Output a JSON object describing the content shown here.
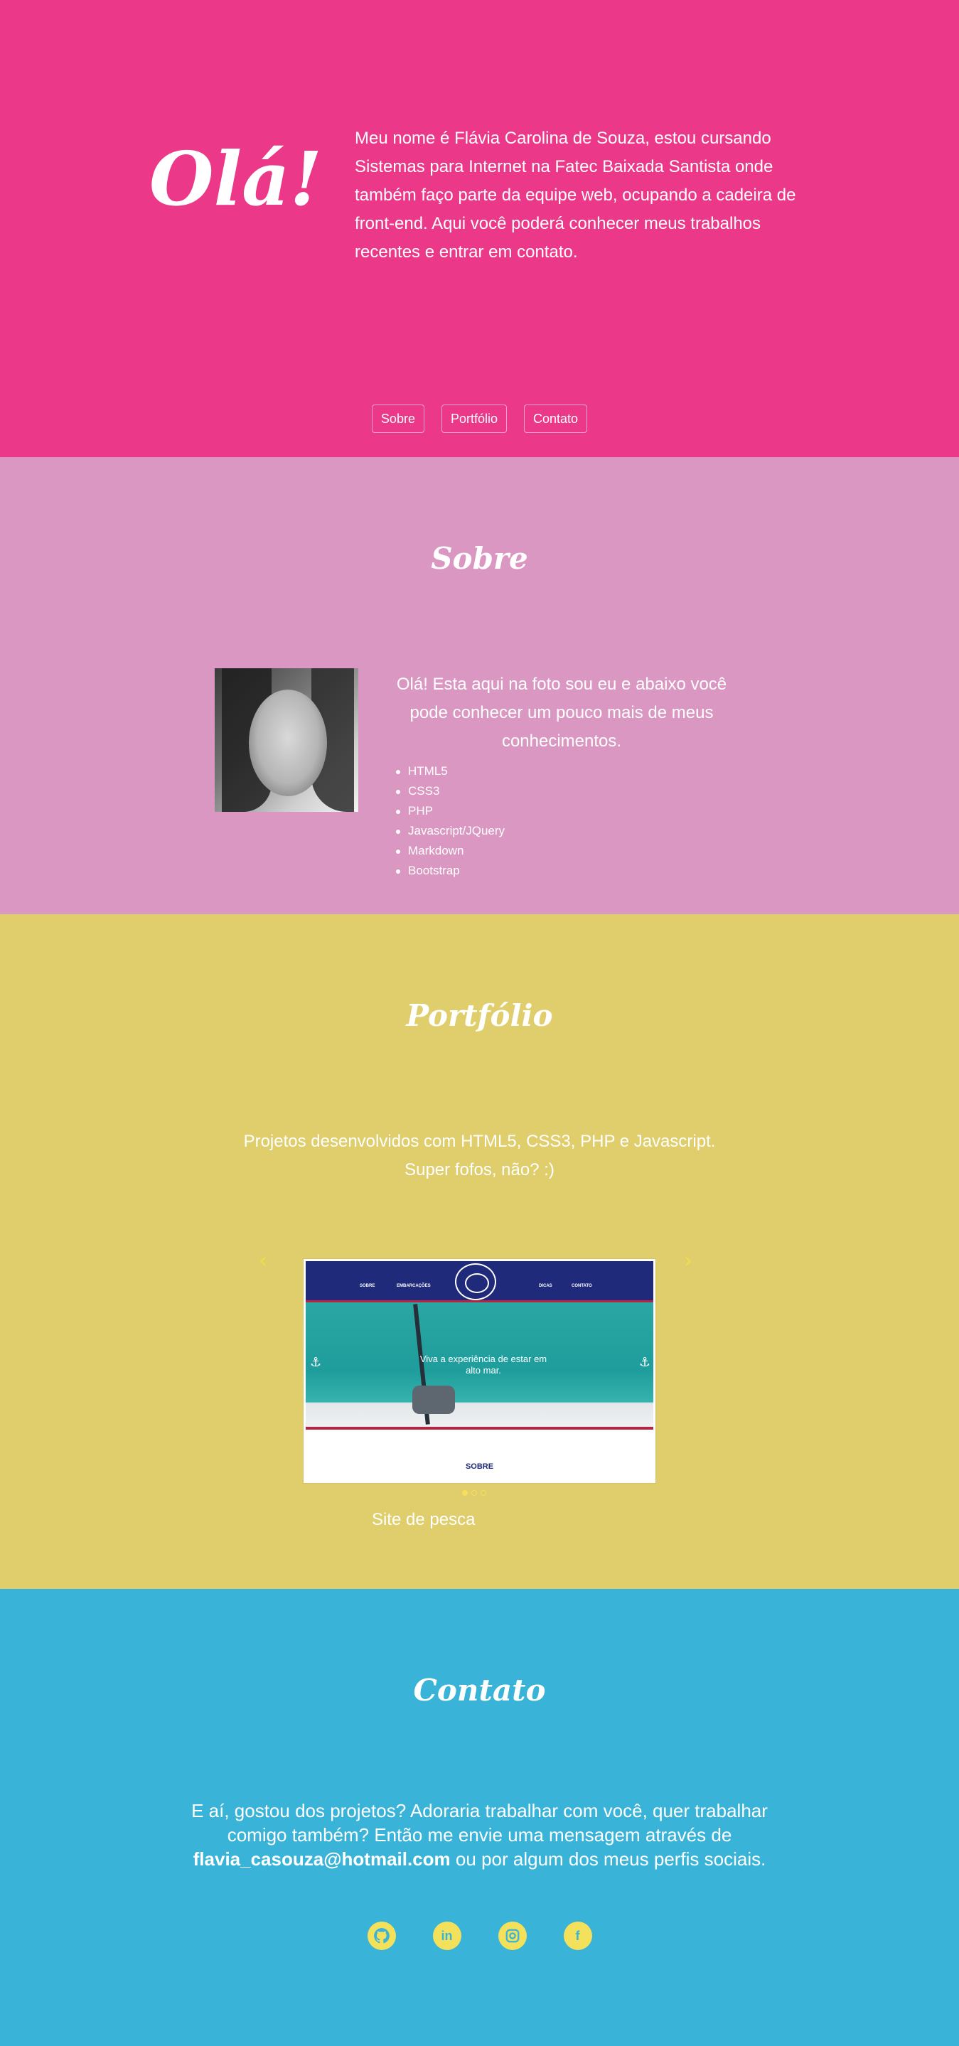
{
  "hero": {
    "title": "Olá!",
    "text": "Meu nome é Flávia Carolina de Souza, estou cursando Sistemas para Internet na Fatec Baixada Santista onde também faço parte da equipe web, ocupando a cadeira de front-end. Aqui você poderá conhecer meus trabalhos recentes e entrar em contato.",
    "nav": [
      "Sobre",
      "Portfólio",
      "Contato"
    ],
    "background": "#ec3888"
  },
  "sobre": {
    "title": "Sobre",
    "intro": "Olá! Esta aqui na foto sou eu e abaixo você pode conhecer um pouco mais de meus conhecimentos.",
    "skills": [
      "HTML5",
      "CSS3",
      "PHP",
      "Javascript/JQuery",
      "Markdown",
      "Bootstrap"
    ],
    "background": "#da97c1"
  },
  "portfolio": {
    "title": "Portfólio",
    "text_line1": "Projetos desenvolvidos com HTML5, CSS3, PHP e Javascript.",
    "text_line2": "Super fofos, não? :)",
    "slide": {
      "menu": [
        "SOBRE",
        "EMBARCAÇÕES",
        "DICAS",
        "CONTATO"
      ],
      "caption": "Viva a experiência de estar em alto mar.",
      "section_label": "SOBRE"
    },
    "slide_caption": "Site de pesca",
    "carousel_dots": 3,
    "active_dot": 1,
    "background": "#e0cd6c"
  },
  "contato": {
    "title": "Contato",
    "text_before": "E aí, gostou dos projetos? Adoraria trabalhar com você, quer trabalhar comigo também? Então me envie uma mensagem através de",
    "email": "flavia_casouza@hotmail.com",
    "text_after": "ou por algum dos meus perfis sociais.",
    "social_icons": [
      "github-icon",
      "linkedin-icon",
      "instagram-icon",
      "facebook-icon"
    ],
    "background": "#39b3d8"
  }
}
